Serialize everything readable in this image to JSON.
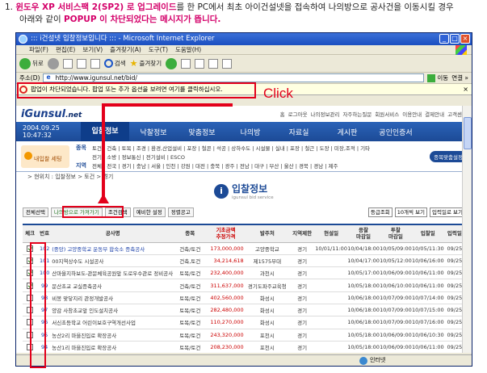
{
  "caption": {
    "line1_prefix": "1. ",
    "line1_hl1": "윈도우 XP 서비스팩 2(SP2) 로 업그레이드",
    "line1_rest": "를 한 PC에서 최초 아이건설넷을 접속하여 나의방으로 공사건을 이동시킬 경우",
    "line2_prefix": "아래와 같이 ",
    "line2_hl": "POPUP 이 차단되었다는 메시지가 뜹니다."
  },
  "window": {
    "title": "::: i건설넷 입찰정보입니다 ::: - Microsoft Internet Explorer",
    "buttons": [
      "_",
      "□",
      "×"
    ]
  },
  "menu": [
    "파일(F)",
    "편집(E)",
    "보기(V)",
    "즐겨찾기(A)",
    "도구(T)",
    "도움말(H)"
  ],
  "toolbar": {
    "back": "뒤로",
    "search": "검색",
    "favorites": "즐겨찾기"
  },
  "address": {
    "label": "주소(D)",
    "url": "http://www.igunsul.net/bid/",
    "go": "이동",
    "links": "연결 »"
  },
  "popup_bar": {
    "message": "팝업이 차단되었습니다.  팝업 또는 추가 옵션을 보려면 여기를 클릭하십시오.",
    "close": "×"
  },
  "click_label": "Click",
  "site": {
    "logo": "iGunsul",
    "logo_suffix": ".net",
    "top_links": [
      "홈",
      "로그아웃",
      "나의정보관리",
      "자주하는질문",
      "회원서비스",
      "이용안내",
      "결제안내",
      "고객센터"
    ],
    "datetime": "2004.09.25 10:47:32",
    "nav_tabs": [
      "입찰정보",
      "낙찰정보",
      "맞춤정보",
      "나의방",
      "자료실",
      "게시판",
      "공인인증서"
    ],
    "myroom_label": "내입찰 세팅",
    "cat_kind": "종목",
    "cat_region": "지역",
    "kind_row1": "토건 | 건축 | 토목 | 조경 | 환경,산업설비 | 포장 | 철콘 | 석공 | 상하수도 | 시설물 | 실내 | 포장 | 철근 | 도장 | 미장,조적 | 기타",
    "kind_row2": "전기 | 소방 | 정보통신 | 전기설비 | ESCO",
    "region_row": "전체 | 전국 | 경기 | 충남 | 서울 | 인천 | 강원 | 대전 | 충북 | 광주 | 전남 | 대구 | 부산 | 울산 | 경북 | 경남 | 제주",
    "custom_button": "종목맞춤설정",
    "breadcrumb": "> 현위치 : 입찰정보 > 토건 > 경기"
  },
  "heading": {
    "title": "입찰정보",
    "subtitle": "igunsul bid service"
  },
  "controls": {
    "select_all": "전체선택",
    "move_to_myroom": "나의방으로 가져가기",
    "condition_search": "조건검색",
    "advanced": "예비한 설정",
    "sort_info": "정렬공고",
    "sort_select": "등급조회",
    "per_page": "10개씩 보기",
    "order_select": "입력일로 보기"
  },
  "table": {
    "headers": [
      "체크",
      "번호",
      "공사명",
      "종목",
      "기초금액\n추정가격",
      "발주처",
      "지역제한",
      "현설일",
      "응찰\n마감일",
      "투찰\n마감일",
      "입찰일",
      "입력일"
    ],
    "rows": [
      {
        "checked": true,
        "no": "102",
        "title": "(중앙) 고양중학교 운동부 합숙소 증축공사",
        "kind": "건축/토건",
        "price": "173,000,000",
        "org": "고양중학교",
        "region": "경기",
        "site": "10/01/11:00",
        "reg_close": "10/04/18:00",
        "bid_close": "10/05/09:00",
        "bid": "10/05/11:30",
        "input": "09/25"
      },
      {
        "checked": true,
        "no": "101",
        "title": "00지역상수도 시설공사",
        "kind": "건축,토건",
        "price": "34,214,618",
        "org": "제1575부대",
        "region": "경기",
        "site": "",
        "reg_close": "10/04/17:00",
        "bid_close": "10/05/12:00",
        "bid": "10/06/16:00",
        "input": "09/25"
      },
      {
        "checked": true,
        "no": "100",
        "title": "산마을지하보도-관문체육공원앞 도로우수관로 정비공사",
        "kind": "토목/토건",
        "price": "232,400,000",
        "org": "과천시",
        "region": "경기",
        "site": "",
        "reg_close": "10/05/17:00",
        "bid_close": "10/06/09:00",
        "bid": "10/06/11:00",
        "input": "09/25"
      },
      {
        "checked": true,
        "no": "99",
        "title": "문산초교 교실증축공사",
        "kind": "건축/토건",
        "price": "311,637,000",
        "org": "경기도파주교육청",
        "region": "경기",
        "site": "",
        "reg_close": "10/05/18:00",
        "bid_close": "10/06/10:00",
        "bid": "10/06/11:00",
        "input": "09/25"
      },
      {
        "checked": false,
        "no": "98",
        "title": "비봉 맞닿지리 관정개발공사",
        "kind": "토목/토건",
        "price": "402,560,000",
        "org": "화성시",
        "region": "경기",
        "site": "",
        "reg_close": "10/06/18:00",
        "bid_close": "10/07/09:00",
        "bid": "10/07/14:00",
        "input": "09/25"
      },
      {
        "checked": false,
        "no": "97",
        "title": "양감 사창초교앞 인도설치공사",
        "kind": "토목/토건",
        "price": "282,480,000",
        "org": "화성시",
        "region": "경기",
        "site": "",
        "reg_close": "10/06/18:00",
        "bid_close": "10/07/09:00",
        "bid": "10/07/15:00",
        "input": "09/25"
      },
      {
        "checked": false,
        "no": "96",
        "title": "서신초등학교 어린이보호구역개선사업",
        "kind": "토목/토건",
        "price": "110,270,000",
        "org": "화성시",
        "region": "경기",
        "site": "",
        "reg_close": "10/06/18:00",
        "bid_close": "10/07/09:00",
        "bid": "10/07/16:00",
        "input": "09/25"
      },
      {
        "checked": false,
        "no": "95",
        "title": "농산2리 마을진입로 확장공사",
        "kind": "토목/토건",
        "price": "243,320,000",
        "org": "포천시",
        "region": "경기",
        "site": "",
        "reg_close": "10/05/18:00",
        "bid_close": "10/06/09:00",
        "bid": "10/06/10:30",
        "input": "09/25"
      },
      {
        "checked": false,
        "no": "94",
        "title": "농산1리 마을진입로 확장공사",
        "kind": "토목/토건",
        "price": "208,230,000",
        "org": "포천시",
        "region": "경기",
        "site": "",
        "reg_close": "10/05/18:00",
        "bid_close": "10/06/09:00",
        "bid": "10/06/11:00",
        "input": "09/25"
      }
    ]
  },
  "status": {
    "zone": "인터넷"
  },
  "colors": {
    "annotation_red": "#e3001b",
    "caption_highlight": "#d4006a",
    "site_blue": "#1c4a96",
    "xp_title": "#1b4fc0"
  }
}
